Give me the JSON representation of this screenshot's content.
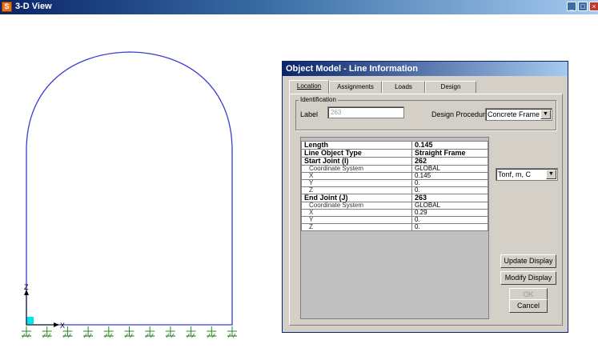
{
  "window": {
    "title": "3-D View",
    "app_icon": "sap-icon"
  },
  "dialog": {
    "title": "Object Model - Line Information",
    "tabs": [
      "Location",
      "Assignments",
      "Loads",
      "Design"
    ],
    "active_tab": 0,
    "identification": {
      "group_title": "Identification",
      "label_caption": "Label",
      "label_value": "263",
      "design_procedure_caption": "Design Procedure",
      "design_procedure_value": "Concrete Frame"
    },
    "table": [
      {
        "key": "Length",
        "value": "0.145",
        "style": "head"
      },
      {
        "key": "Line Object Type",
        "value": "Straight Frame",
        "style": "head"
      },
      {
        "key": "Start Joint (I)",
        "value": "262",
        "style": "head"
      },
      {
        "key": "Coordinate System",
        "value": "GLOBAL",
        "style": "sub"
      },
      {
        "key": "X",
        "value": "0.145",
        "style": "sub"
      },
      {
        "key": "Y",
        "value": "0.",
        "style": "sub"
      },
      {
        "key": "Z",
        "value": "0.",
        "style": "sub"
      },
      {
        "key": "End Joint (J)",
        "value": "263",
        "style": "head"
      },
      {
        "key": "Coordinate System",
        "value": "GLOBAL",
        "style": "sub"
      },
      {
        "key": "X",
        "value": "0.29",
        "style": "sub"
      },
      {
        "key": "Y",
        "value": "0.",
        "style": "sub"
      },
      {
        "key": "Z",
        "value": "0.",
        "style": "sub"
      }
    ],
    "units_value": "Tonf, m, C",
    "buttons": {
      "update_display": "Update Display",
      "modify_display": "Modify Display",
      "ok": "OK",
      "cancel": "Cancel"
    }
  },
  "view": {
    "axis_labels": {
      "x": "X",
      "z": "Z"
    },
    "support_count": 11,
    "structure_color": "#3b3bd6",
    "support_color": "#2a8a2a",
    "selection_color": "#00e5ee"
  }
}
